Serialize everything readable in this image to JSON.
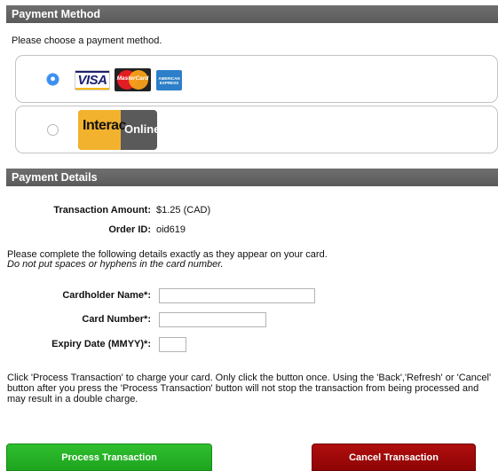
{
  "payment_method": {
    "header": "Payment Method",
    "instruction": "Please choose a payment method.",
    "options": [
      {
        "selected": true,
        "logos": [
          "VISA",
          "MasterCard",
          "AMERICAN EXPRESS"
        ]
      },
      {
        "selected": false,
        "logos": [
          "Interac",
          "Online"
        ]
      }
    ]
  },
  "payment_details": {
    "header": "Payment Details",
    "transaction_amount_label": "Transaction Amount:",
    "transaction_amount_value": "$1.25 (CAD)",
    "order_id_label": "Order ID:",
    "order_id_value": "oid619",
    "instruction_line1": "Please complete the following details exactly as they appear on your card.",
    "instruction_line2": "Do not put spaces or hyphens in the card number.",
    "cardholder_label": "Cardholder Name*:",
    "cardholder_value": "",
    "card_number_label": "Card Number*:",
    "card_number_value": "",
    "expiry_label": "Expiry Date (MMYY)*:",
    "expiry_value": "",
    "warning": "Click 'Process Transaction' to charge your card. Only click the button once. Using the 'Back','Refresh' or 'Cancel' button after you press the 'Process Transaction' button will not stop the transaction from being processed and may result in a double charge."
  },
  "buttons": {
    "process": "Process Transaction",
    "cancel": "Cancel Transaction"
  },
  "colors": {
    "header_bg": "#5f5f5f",
    "process_bg": "#22b022",
    "cancel_bg": "#9d0808",
    "radio_selected": "#3b8ff0"
  }
}
